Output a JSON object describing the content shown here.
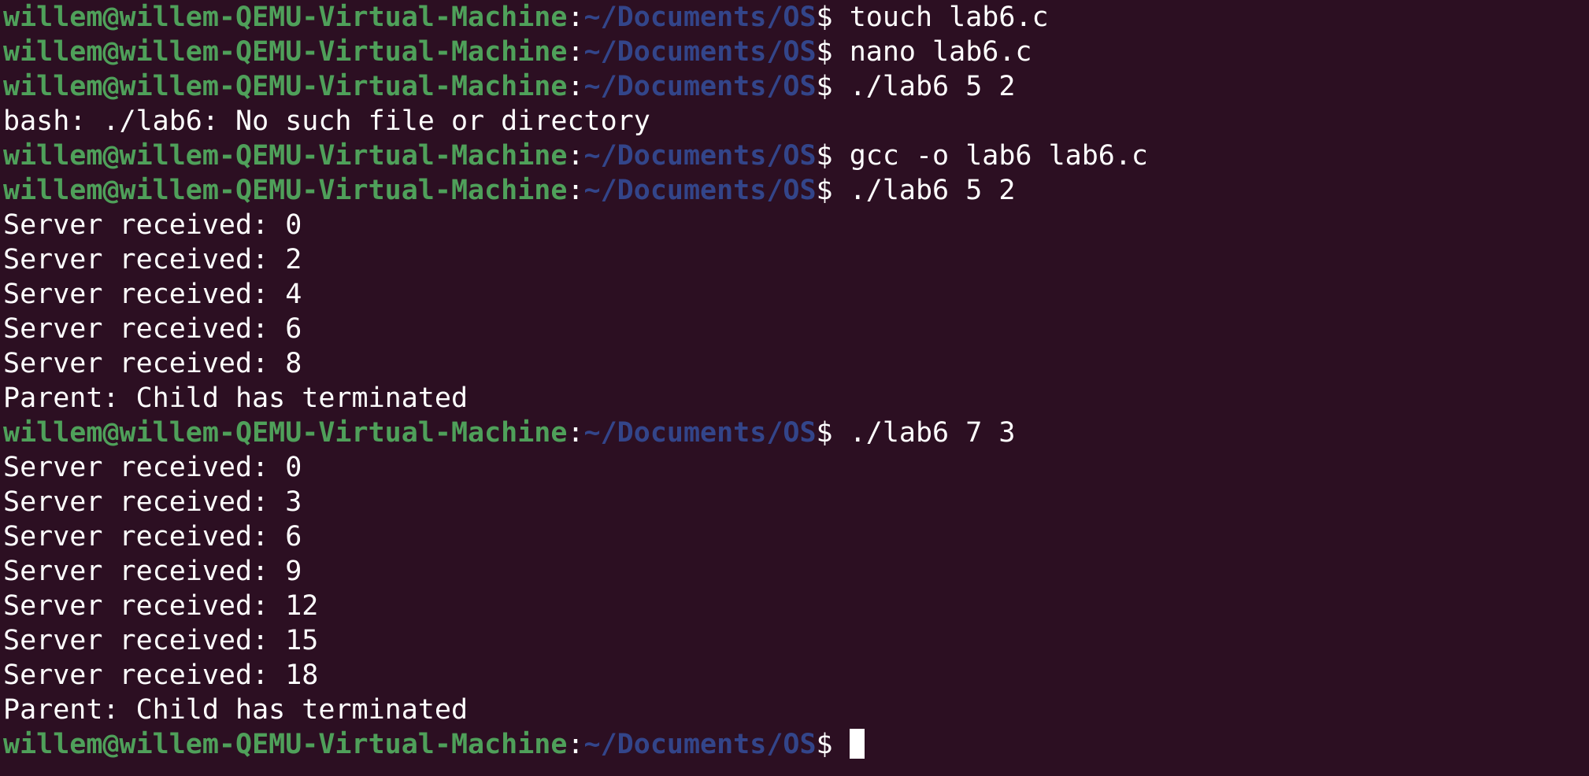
{
  "theme": {
    "background": "#2c0f22",
    "prompt_user_color": "#4fa05a",
    "prompt_path_color": "#33458a",
    "text_color": "#ffffff"
  },
  "lines": [
    {
      "type": "prompt",
      "user": "willem@willem-QEMU-Virtual-Machine",
      "path": "~/Documents/OS",
      "command": "touch lab6.c"
    },
    {
      "type": "prompt",
      "user": "willem@willem-QEMU-Virtual-Machine",
      "path": "~/Documents/OS",
      "command": "nano lab6.c"
    },
    {
      "type": "prompt",
      "user": "willem@willem-QEMU-Virtual-Machine",
      "path": "~/Documents/OS",
      "command": "./lab6 5 2"
    },
    {
      "type": "output",
      "text": "bash: ./lab6: No such file or directory"
    },
    {
      "type": "prompt",
      "user": "willem@willem-QEMU-Virtual-Machine",
      "path": "~/Documents/OS",
      "command": "gcc -o lab6 lab6.c"
    },
    {
      "type": "prompt",
      "user": "willem@willem-QEMU-Virtual-Machine",
      "path": "~/Documents/OS",
      "command": "./lab6 5 2"
    },
    {
      "type": "output",
      "text": "Server received: 0"
    },
    {
      "type": "output",
      "text": "Server received: 2"
    },
    {
      "type": "output",
      "text": "Server received: 4"
    },
    {
      "type": "output",
      "text": "Server received: 6"
    },
    {
      "type": "output",
      "text": "Server received: 8"
    },
    {
      "type": "output",
      "text": "Parent: Child has terminated"
    },
    {
      "type": "prompt",
      "user": "willem@willem-QEMU-Virtual-Machine",
      "path": "~/Documents/OS",
      "command": "./lab6 7 3"
    },
    {
      "type": "output",
      "text": "Server received: 0"
    },
    {
      "type": "output",
      "text": "Server received: 3"
    },
    {
      "type": "output",
      "text": "Server received: 6"
    },
    {
      "type": "output",
      "text": "Server received: 9"
    },
    {
      "type": "output",
      "text": "Server received: 12"
    },
    {
      "type": "output",
      "text": "Server received: 15"
    },
    {
      "type": "output",
      "text": "Server received: 18"
    },
    {
      "type": "output",
      "text": "Parent: Child has terminated"
    }
  ],
  "current_prompt": {
    "user": "willem@willem-QEMU-Virtual-Machine",
    "path": "~/Documents/OS",
    "command": ""
  }
}
